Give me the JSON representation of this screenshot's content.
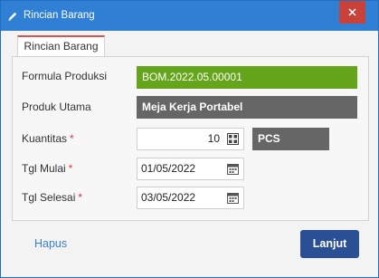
{
  "window": {
    "title": "Rincian Barang",
    "close_glyph": "×"
  },
  "tab": {
    "label": "Rincian Barang"
  },
  "form": {
    "formula_label": "Formula Produksi",
    "formula_value": "BOM.2022.05.00001",
    "product_label": "Produk Utama",
    "product_value": "Meja Kerja Portabel",
    "qty_label": "Kuantitas",
    "qty_value": "10",
    "unit_value": "PCS",
    "start_label": "Tgl Mulai",
    "start_value": "01/05/2022",
    "end_label": "Tgl Selesai",
    "end_value": "03/05/2022",
    "required_mark": "*"
  },
  "actions": {
    "delete_label": "Hapus",
    "next_label": "Lanjut"
  },
  "colors": {
    "titlebar": "#2f7fd4",
    "formula_bg": "#64a51b",
    "product_bg": "#666666",
    "primary_button": "#2a4f95",
    "link": "#3a7fd0"
  }
}
